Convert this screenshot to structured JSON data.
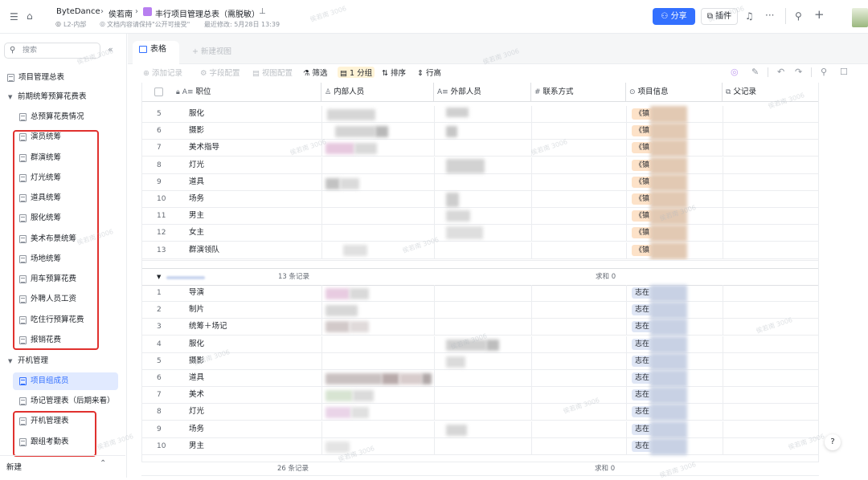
{
  "topbar": {
    "breadcrumb": {
      "workspace": "ByteDance",
      "owner": "侯若南",
      "title": "丰行项目管理总表（需脱敏）"
    },
    "sub": {
      "level": "L2-内部",
      "notice": "文档内容请保持\"公开可接受\"",
      "modified": "最近修改: 5月28日 13:39"
    },
    "share_label": "分享",
    "plugin_label": "插件"
  },
  "sidebar": {
    "search_placeholder": "搜索",
    "items": [
      {
        "label": "项目管理总表",
        "type": "doc",
        "indent": 0
      },
      {
        "label": "前期统筹预算花费表",
        "type": "folder",
        "indent": 0
      },
      {
        "label": "总预算花费情况",
        "type": "doc",
        "indent": 1
      },
      {
        "label": "演员统筹",
        "type": "doc",
        "indent": 1
      },
      {
        "label": "群演统筹",
        "type": "doc",
        "indent": 1
      },
      {
        "label": "灯光统筹",
        "type": "doc",
        "indent": 1
      },
      {
        "label": "道具统筹",
        "type": "doc",
        "indent": 1
      },
      {
        "label": "服化统筹",
        "type": "doc",
        "indent": 1
      },
      {
        "label": "美术布景统筹",
        "type": "doc",
        "indent": 1
      },
      {
        "label": "场地统筹",
        "type": "doc",
        "indent": 1
      },
      {
        "label": "用车预算花费",
        "type": "doc",
        "indent": 1
      },
      {
        "label": "外聘人员工资",
        "type": "doc",
        "indent": 1
      },
      {
        "label": "吃住行预算花费",
        "type": "doc",
        "indent": 1
      },
      {
        "label": "报销花费",
        "type": "doc",
        "indent": 1
      },
      {
        "label": "开机管理",
        "type": "folder",
        "indent": 0
      },
      {
        "label": "项目组成员",
        "type": "doc",
        "indent": 1,
        "selected": true
      },
      {
        "label": "场记管理表（后期来看）",
        "type": "doc",
        "indent": 1
      },
      {
        "label": "开机管理表",
        "type": "doc",
        "indent": 1
      },
      {
        "label": "跟组考勤表",
        "type": "doc",
        "indent": 1
      }
    ],
    "new_label": "新建"
  },
  "tabs": {
    "active": "表格",
    "add": "+ 新建视图"
  },
  "toolbar": {
    "add_record": "添加记录",
    "field_config": "字段配置",
    "view_config": "视图配置",
    "filter": "筛选",
    "group": "1 分组",
    "sort": "排序",
    "row_height": "行高"
  },
  "columns": [
    "职位",
    "内部人员",
    "外部人员",
    "联系方式",
    "项目信息",
    "父记录"
  ],
  "group1": {
    "rows": [
      {
        "n": "5",
        "pos": "服化",
        "tag": "《镇"
      },
      {
        "n": "6",
        "pos": "摄影",
        "tag": "《镇"
      },
      {
        "n": "7",
        "pos": "美术指导",
        "tag": "《镇"
      },
      {
        "n": "8",
        "pos": "灯光",
        "tag": "《镇"
      },
      {
        "n": "9",
        "pos": "道具",
        "tag": "《镇"
      },
      {
        "n": "10",
        "pos": "场务",
        "tag": "《镇"
      },
      {
        "n": "11",
        "pos": "男主",
        "tag": "《镇"
      },
      {
        "n": "12",
        "pos": "女主",
        "tag": "《镇"
      },
      {
        "n": "13",
        "pos": "群演领队",
        "tag": "《镇"
      }
    ]
  },
  "group2": {
    "count": "13 条记录",
    "sum": "求和 0",
    "rows": [
      {
        "n": "1",
        "pos": "导演",
        "tag": "志在"
      },
      {
        "n": "2",
        "pos": "制片",
        "tag": "志在"
      },
      {
        "n": "3",
        "pos": "统筹＋场记",
        "tag": "志在"
      },
      {
        "n": "4",
        "pos": "服化",
        "tag": "志在"
      },
      {
        "n": "5",
        "pos": "摄影",
        "tag": "志在"
      },
      {
        "n": "6",
        "pos": "道具",
        "tag": "志在"
      },
      {
        "n": "7",
        "pos": "美术",
        "tag": "志在"
      },
      {
        "n": "8",
        "pos": "灯光",
        "tag": "志在"
      },
      {
        "n": "9",
        "pos": "场务",
        "tag": "志在"
      },
      {
        "n": "10",
        "pos": "男主",
        "tag": "志在"
      }
    ]
  },
  "footer": {
    "count": "26 条记录",
    "sum": "求和 0"
  },
  "watermark": "侯若南 3006",
  "colors": {
    "accent": "#3370ff",
    "highlight": "#e0312e",
    "tag_orange": "#fde2c8",
    "tag_blue": "#dfe6f5"
  }
}
